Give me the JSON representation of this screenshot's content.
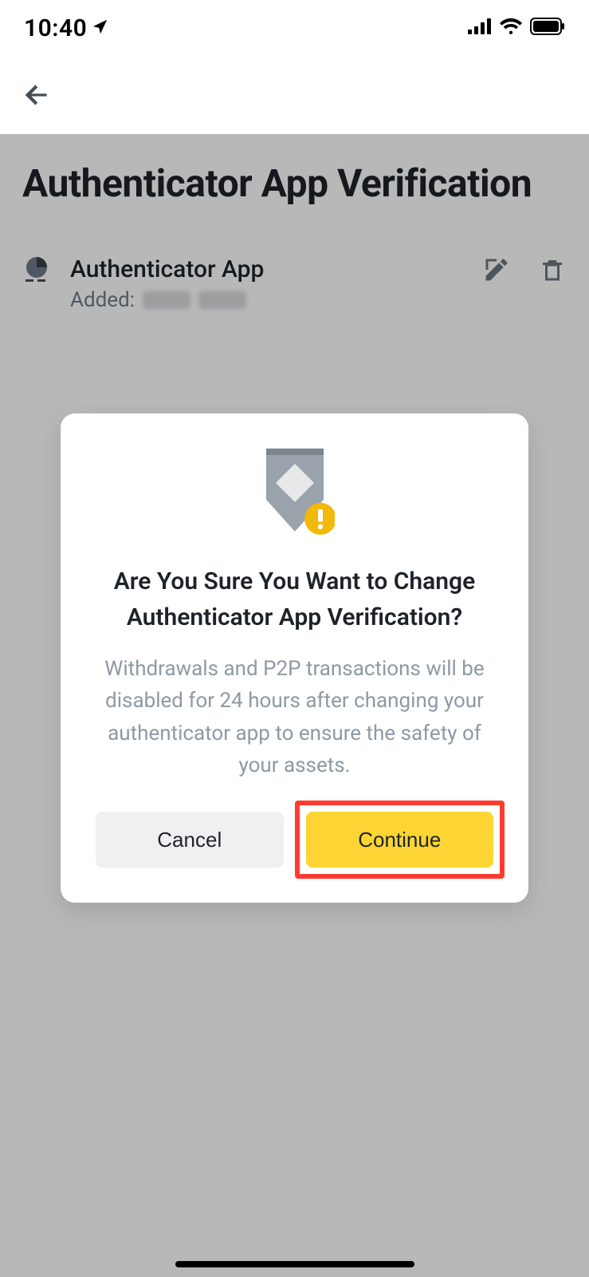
{
  "status": {
    "time": "10:40"
  },
  "nav": {},
  "page": {
    "title": "Authenticator App Verification",
    "item": {
      "name": "Authenticator App",
      "added_label": "Added:"
    }
  },
  "modal": {
    "title": "Are You Sure You Want to Change Authenticator App Verification?",
    "body": "Withdrawals and P2P transactions will be disabled for 24 hours after changing your authenticator app to ensure the safety of your assets.",
    "cancel": "Cancel",
    "continue": "Continue"
  },
  "colors": {
    "accent": "#fcd535",
    "highlight": "#ff3b30"
  }
}
